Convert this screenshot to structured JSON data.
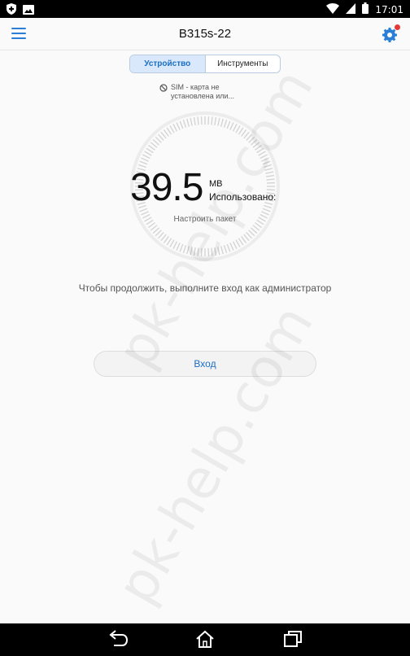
{
  "status_bar": {
    "time": "17:01"
  },
  "app_bar": {
    "title": "B315s-22"
  },
  "tabs": [
    {
      "label": "Устройство",
      "active": true
    },
    {
      "label": "Инструменты",
      "active": false
    }
  ],
  "sim_note": "SIM - карта не установлена или...",
  "usage": {
    "value": "39.5",
    "unit": "MB",
    "label": "Использовано:",
    "package_link": "Настроить пакет"
  },
  "login_hint": "Чтобы продолжить, выполните вход как администратор",
  "login_button": "Вход",
  "watermark": "pk-help.com",
  "colors": {
    "accent": "#1b6fc4",
    "badge": "#e53935",
    "bar": "#000000"
  },
  "icons": [
    "shield-icon",
    "image-icon",
    "wifi-icon",
    "signal-icon",
    "battery-icon",
    "menu-icon",
    "settings-gear-icon",
    "no-sim-icon",
    "back-icon",
    "home-icon",
    "recents-icon"
  ]
}
